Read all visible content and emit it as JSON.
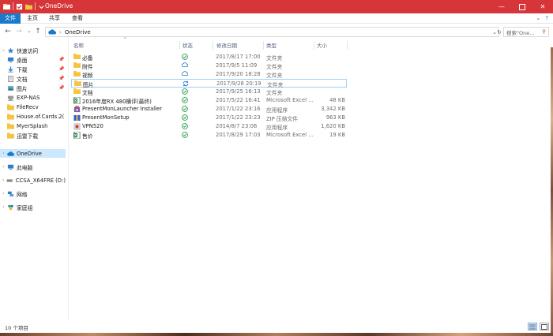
{
  "window": {
    "title": "OneDrive"
  },
  "colors": {
    "titlebar": "#d6363a",
    "accent": "#1979ca",
    "folder": "#f5c542",
    "synced": "#2e9d4e",
    "cloud": "#1979ca",
    "selection": "#cce8ff"
  },
  "ribbon": {
    "tabs": [
      "文件",
      "主页",
      "共享",
      "查看"
    ]
  },
  "address": {
    "path": "OneDrive",
    "search_placeholder": "搜索\"One..."
  },
  "nav": {
    "quick_access": "快速访问",
    "items": [
      {
        "label": "桌面",
        "icon": "desktop-icon",
        "pinned": true
      },
      {
        "label": "下载",
        "icon": "download-icon",
        "pinned": true
      },
      {
        "label": "文档",
        "icon": "document-icon",
        "pinned": true
      },
      {
        "label": "图片",
        "icon": "picture-icon",
        "pinned": true
      },
      {
        "label": "EXP-NAS",
        "icon": "folder-icon",
        "pinned": false
      },
      {
        "label": "FileRecv",
        "icon": "folder-icon",
        "pinned": false
      },
      {
        "label": "House.of.Cards.2(",
        "icon": "folder-icon",
        "pinned": false
      },
      {
        "label": "MyerSplash",
        "icon": "folder-icon",
        "pinned": false
      },
      {
        "label": "迅雷下载",
        "icon": "folder-icon",
        "pinned": false
      }
    ],
    "onedrive": "OneDrive",
    "this_pc": "此电脑",
    "drive": "CCSA_X64FRE (D:)",
    "network": "网络",
    "homegroup": "家庭组"
  },
  "columns": {
    "name": "名称",
    "status": "状态",
    "modified": "修改日期",
    "type": "类型",
    "size": "大小"
  },
  "files": [
    {
      "name": "必备",
      "date": "2017/8/17 17:00",
      "type": "文件夹",
      "size": "",
      "icon": "folder-icon",
      "status": "synced-check-icon"
    },
    {
      "name": "附件",
      "date": "2017/9/5 11:09",
      "type": "文件夹",
      "size": "",
      "icon": "folder-icon",
      "status": "cloud-icon"
    },
    {
      "name": "视频",
      "date": "2017/9/20 18:28",
      "type": "文件夹",
      "size": "",
      "icon": "folder-icon",
      "status": "cloud-icon"
    },
    {
      "name": "图片",
      "date": "2017/9/28 20:19",
      "type": "文件夹",
      "size": "",
      "icon": "folder-icon",
      "status": "sync-pending-icon"
    },
    {
      "name": "文档",
      "date": "2017/9/25 16:13",
      "type": "文件夹",
      "size": "",
      "icon": "folder-icon",
      "status": "synced-check-icon"
    },
    {
      "name": "2016年度RX 480横评(最终)",
      "date": "2017/5/22 16:41",
      "type": "Microsoft Excel ...",
      "size": "48 KB",
      "icon": "excel-icon",
      "status": "synced-check-icon"
    },
    {
      "name": "PresentMonLauncher Installer",
      "date": "2017/1/22 23:16",
      "type": "应用程序",
      "size": "3,342 KB",
      "icon": "installer-icon",
      "status": "synced-check-icon"
    },
    {
      "name": "PresentMonSetup",
      "date": "2017/1/22 23:23",
      "type": "ZIP 压缩文件",
      "size": "963 KB",
      "icon": "zip-icon",
      "status": "synced-check-icon"
    },
    {
      "name": "VPN520",
      "date": "2014/8/7 23:06",
      "type": "应用程序",
      "size": "1,620 KB",
      "icon": "vpn-app-icon",
      "status": "synced-check-icon"
    },
    {
      "name": "售价",
      "date": "2017/8/29 17:03",
      "type": "Microsoft Excel ...",
      "size": "19 KB",
      "icon": "excel-icon",
      "status": "synced-check-icon"
    }
  ],
  "selected_index": 3,
  "status": {
    "count": "10 个项目"
  }
}
